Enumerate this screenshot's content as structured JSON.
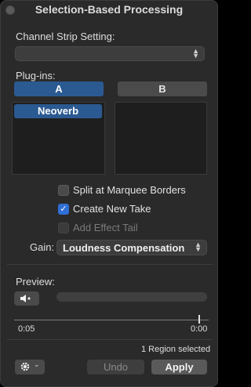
{
  "window": {
    "title": "Selection-Based Processing"
  },
  "channel_strip": {
    "label": "Channel Strip Setting:",
    "value": ""
  },
  "plugins": {
    "label": "Plug-ins:",
    "tab_a": "A",
    "tab_b": "B",
    "slot_a_items": [
      "Neoverb"
    ]
  },
  "options": {
    "split_label": "Split at Marquee Borders",
    "split_checked": false,
    "create_label": "Create New Take",
    "create_checked": true,
    "tail_label": "Add Effect Tail",
    "tail_enabled": false
  },
  "gain": {
    "label": "Gain:",
    "value": "Loudness Compensation"
  },
  "preview": {
    "label": "Preview:",
    "start_time": "0:05",
    "end_time": "0:00",
    "speaker_icon": "speaker-icon"
  },
  "footer": {
    "status": "1 Region selected",
    "undo_label": "Undo",
    "apply_label": "Apply",
    "gear_icon": "gear-icon"
  },
  "colors": {
    "accent": "#2b5a92",
    "checkbox": "#2f6fd6"
  }
}
